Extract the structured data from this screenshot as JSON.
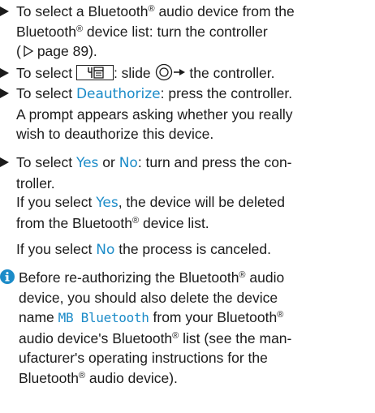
{
  "steps": [
    {
      "line1": "To select a Bluetooth",
      "reg": "®",
      "line1b": " audio device from the",
      "line2a": "Bluetooth",
      "line2b": " device list: turn the controller",
      "line3_open": "(",
      "line3_ref": "page 89",
      "line3_close": ")."
    },
    {
      "prefix": "To select ",
      "middle": ": slide ",
      "suffix": " the controller."
    },
    {
      "prefix": "To select ",
      "highlight": "Deauthorize",
      "suffix": ": press the controller.",
      "line2": "A prompt appears asking whether you really",
      "line3": "wish to deauthorize this device."
    },
    {
      "prefix": "To select ",
      "hl_yes": "Yes",
      "or": " or ",
      "hl_no": "No",
      "suffix": ": turn and press the con-",
      "line2": "troller."
    }
  ],
  "results": [
    {
      "prefix": "If you select ",
      "highlight": "Yes",
      "suffix": ", the device will be deleted",
      "line2a": "from the Bluetooth",
      "line2b": " device list."
    },
    {
      "prefix": "If you select ",
      "highlight": "No",
      "suffix": " the process is canceled."
    }
  ],
  "note": {
    "line1a": "Before re-authorizing the Bluetooth",
    "line1b": " audio",
    "line2": "device, you should also delete the device",
    "line3a": "name ",
    "line3_hl": "MB Bluetooth",
    "line3b": " from your Bluetooth",
    "line4a": "audio device's Bluetooth",
    "line4b": " list (see the man-",
    "line5": "ufacturer's operating instructions for the",
    "line6a": "Bluetooth",
    "line6b": " audio device)."
  },
  "reg_mark": "®",
  "colors": {
    "highlight": "#1b8bc8",
    "text": "#1b1b1b"
  },
  "icons": {
    "bullet": "triangle-bullet-icon",
    "ref": "page-reference-triangle-icon",
    "menu": "menu-button-icon",
    "controller": "controller-slide-right-icon",
    "info": "info-icon"
  }
}
